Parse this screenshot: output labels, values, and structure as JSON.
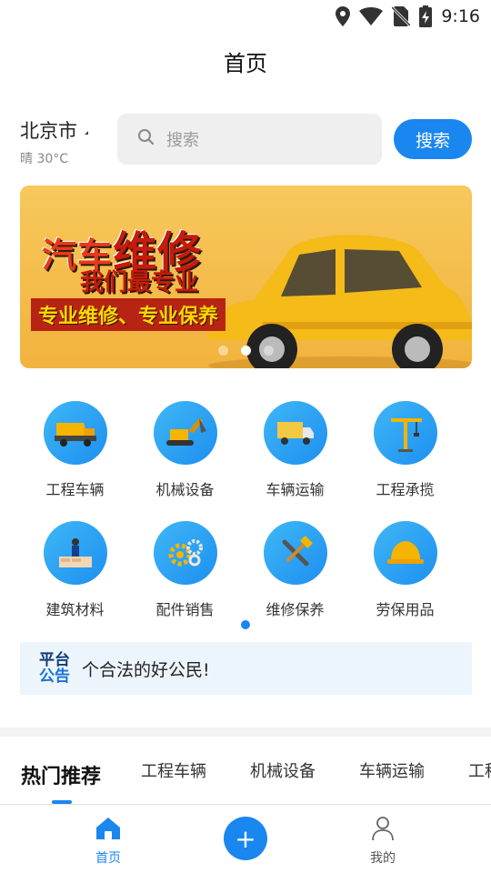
{
  "status_bar": {
    "time": "9:16",
    "icons": [
      "location-icon",
      "wifi-icon",
      "no-sim-icon",
      "battery-charging-icon"
    ]
  },
  "header": {
    "title": "首页"
  },
  "location": {
    "city": "北京市",
    "weather": "晴 30°C"
  },
  "search": {
    "placeholder": "搜索",
    "button_label": "搜索"
  },
  "banner": {
    "line1_a": "汽车",
    "line1_b": "维修",
    "line2": "我们最专业",
    "line3": "专业维修、专业保养",
    "slides": 3,
    "active_slide": 2
  },
  "categories": [
    {
      "label": "工程车辆",
      "icon": "dump-truck-icon"
    },
    {
      "label": "机械设备",
      "icon": "excavator-icon"
    },
    {
      "label": "车辆运输",
      "icon": "truck-icon"
    },
    {
      "label": "工程承揽",
      "icon": "tower-crane-icon"
    },
    {
      "label": "建筑材料",
      "icon": "building-materials-icon"
    },
    {
      "label": "配件销售",
      "icon": "gears-icon"
    },
    {
      "label": "维修保养",
      "icon": "wrench-hammer-icon"
    },
    {
      "label": "劳保用品",
      "icon": "hard-hat-icon"
    }
  ],
  "notice": {
    "badge_line1": "平台",
    "badge_line2": "公告",
    "text": "个合法的好公民!"
  },
  "tabs": [
    "热门推荐",
    "工程车辆",
    "机械设备",
    "车辆运输",
    "工程"
  ],
  "bottom_nav": {
    "home_label": "首页",
    "mine_label": "我的",
    "add_label": "+"
  },
  "colors": {
    "accent": "#1a86f0",
    "banner": "#f1b33d",
    "notice_bg": "#edf5fc"
  }
}
